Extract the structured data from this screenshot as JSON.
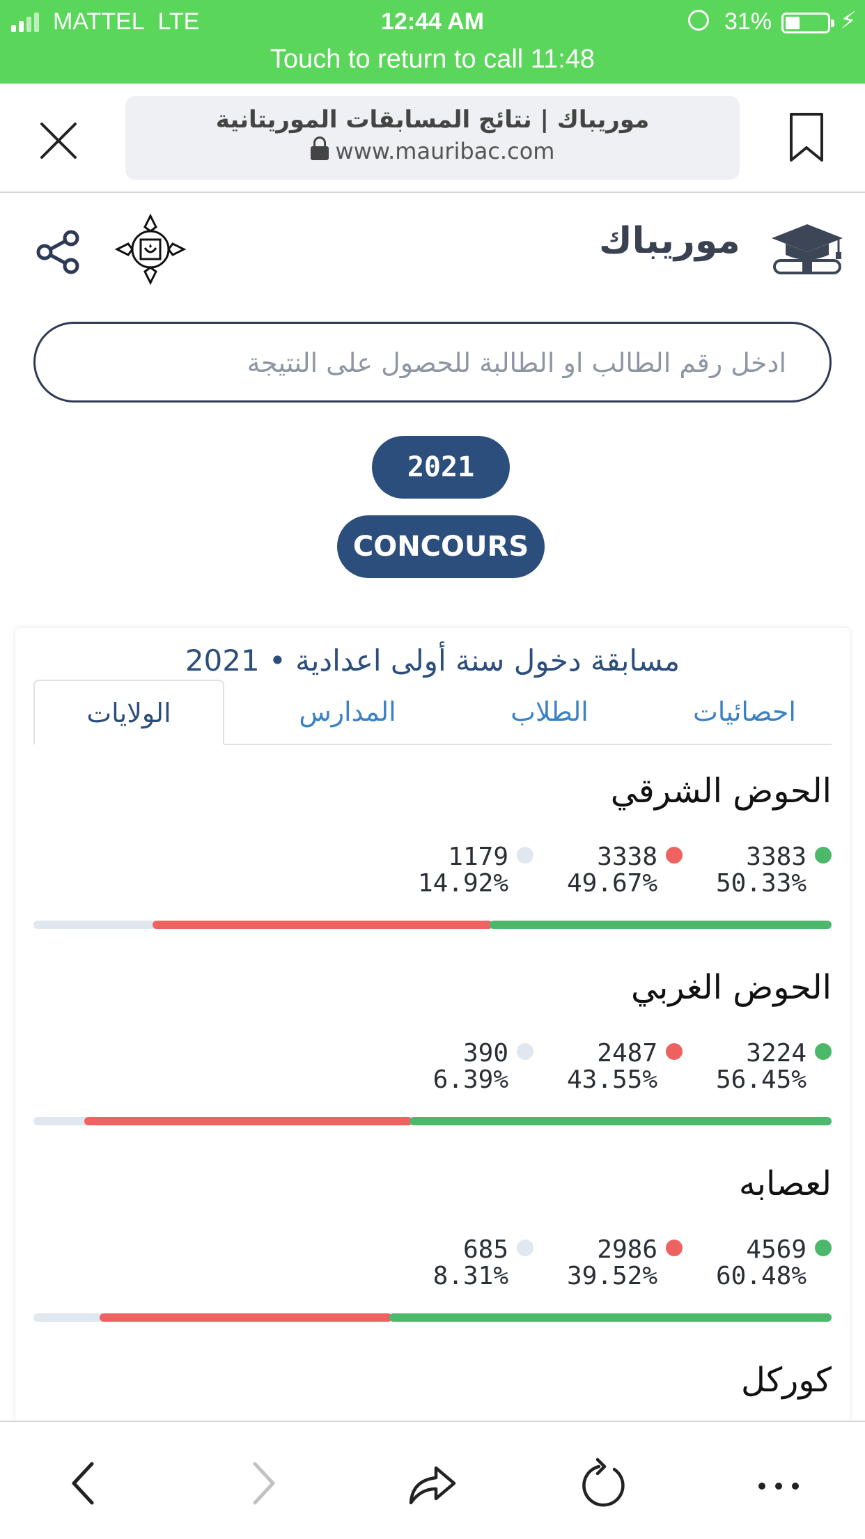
{
  "status_bar": {
    "carrier": "MATTEL",
    "network": "LTE",
    "time": "12:44 AM",
    "battery_pct": "31%",
    "call_banner": "Touch to return to call 11:48",
    "bar_color": "#5ad65a"
  },
  "browser": {
    "page_title": "موريباك | نتائج المسابقات الموريتانية",
    "url": "www.mauribac.com"
  },
  "site": {
    "name": "موريباك",
    "search_placeholder": "ادخل رقم الطالب او الطالبة للحصول على النتيجة",
    "year_button": "2021",
    "exam_button": "CONCOURS"
  },
  "card": {
    "title": "مسابقة دخول سنة أولى اعدادية • 2021",
    "tabs": [
      "احصائيات",
      "الطلاب",
      "المدارس",
      "الولايات"
    ],
    "active_tab": "الولايات"
  },
  "colors": {
    "pass": "#4cb86a",
    "fail": "#ef6262",
    "absent": "#e1e7ef",
    "accent": "#2c4e7d"
  },
  "regions": [
    {
      "name": "الحوض الشرقي",
      "passed": "3383",
      "passed_pct": "50.33%",
      "failed": "3338",
      "failed_pct": "49.67%",
      "absent": "1179",
      "absent_pct": "14.92%"
    },
    {
      "name": "الحوض الغربي",
      "passed": "3224",
      "passed_pct": "56.45%",
      "failed": "2487",
      "failed_pct": "43.55%",
      "absent": "390",
      "absent_pct": "6.39%"
    },
    {
      "name": "لعصابه",
      "passed": "4569",
      "passed_pct": "60.48%",
      "failed": "2986",
      "failed_pct": "39.52%",
      "absent": "685",
      "absent_pct": "8.31%"
    },
    {
      "name": "كوركل"
    }
  ],
  "toolbar_icons": [
    "back-icon",
    "forward-icon",
    "share-icon",
    "reload-icon",
    "more-icon"
  ]
}
